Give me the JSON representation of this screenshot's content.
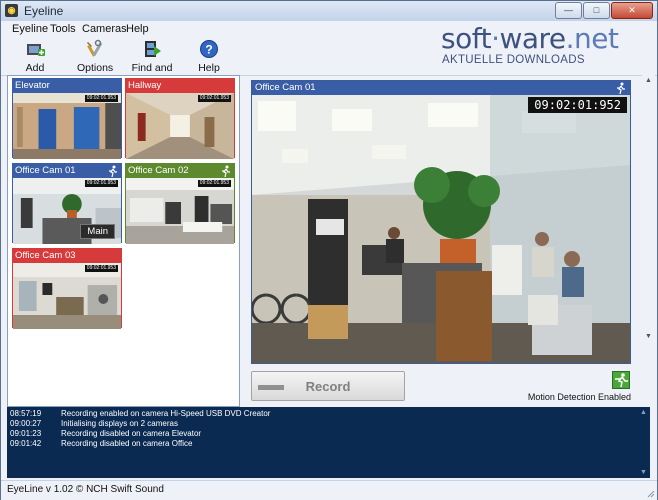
{
  "window": {
    "title": "Eyeline",
    "minimize": "—",
    "maximize": "□",
    "close": "✕"
  },
  "menu": [
    "Eyeline",
    "Tools",
    "Cameras",
    "Help"
  ],
  "toolbar": [
    {
      "label": "Add Camera",
      "icon": "add-camera-icon"
    },
    {
      "label": "Options",
      "icon": "options-icon"
    },
    {
      "label": "Find and Play",
      "icon": "find-and-play-icon"
    },
    {
      "label": "Help",
      "icon": "help-icon"
    }
  ],
  "watermark": {
    "main_a": "soft",
    "main_b": "ware",
    "main_c": ".net",
    "sub": "AKTUELLE DOWNLOADS"
  },
  "cameras": [
    {
      "name": "Elevator",
      "color": "#3a5ea6",
      "timestamp": "09:02:01.953"
    },
    {
      "name": "Hallway",
      "color": "#d63a3a",
      "timestamp": "09:02:01.953"
    },
    {
      "name": "Office Cam 01",
      "color": "#3a5ea6",
      "timestamp": "09:02:01.953",
      "badge": "Main"
    },
    {
      "name": "Office Cam 02",
      "color": "#5d8a2e",
      "timestamp": "09:02:01.953"
    },
    {
      "name": "Office Cam 03",
      "color": "#d63a3a",
      "timestamp": "09:02:01.953"
    }
  ],
  "viewer": {
    "title": "Office Cam 01",
    "clock": "09:02:01:952"
  },
  "record": {
    "label": "Record"
  },
  "motion": {
    "label": "Motion Detection Enabled"
  },
  "log": [
    {
      "time": "08:57:19",
      "msg": "Recording enabled on camera Hi-Speed USB DVD Creator"
    },
    {
      "time": "09:00:27",
      "msg": "Initialising displays on 2 cameras"
    },
    {
      "time": "09:01:23",
      "msg": "Recording disabled on camera Elevator"
    },
    {
      "time": "09:01:42",
      "msg": "Recording disabled on camera Office"
    }
  ],
  "status": "EyeLine v 1.02 © NCH Swift Sound"
}
